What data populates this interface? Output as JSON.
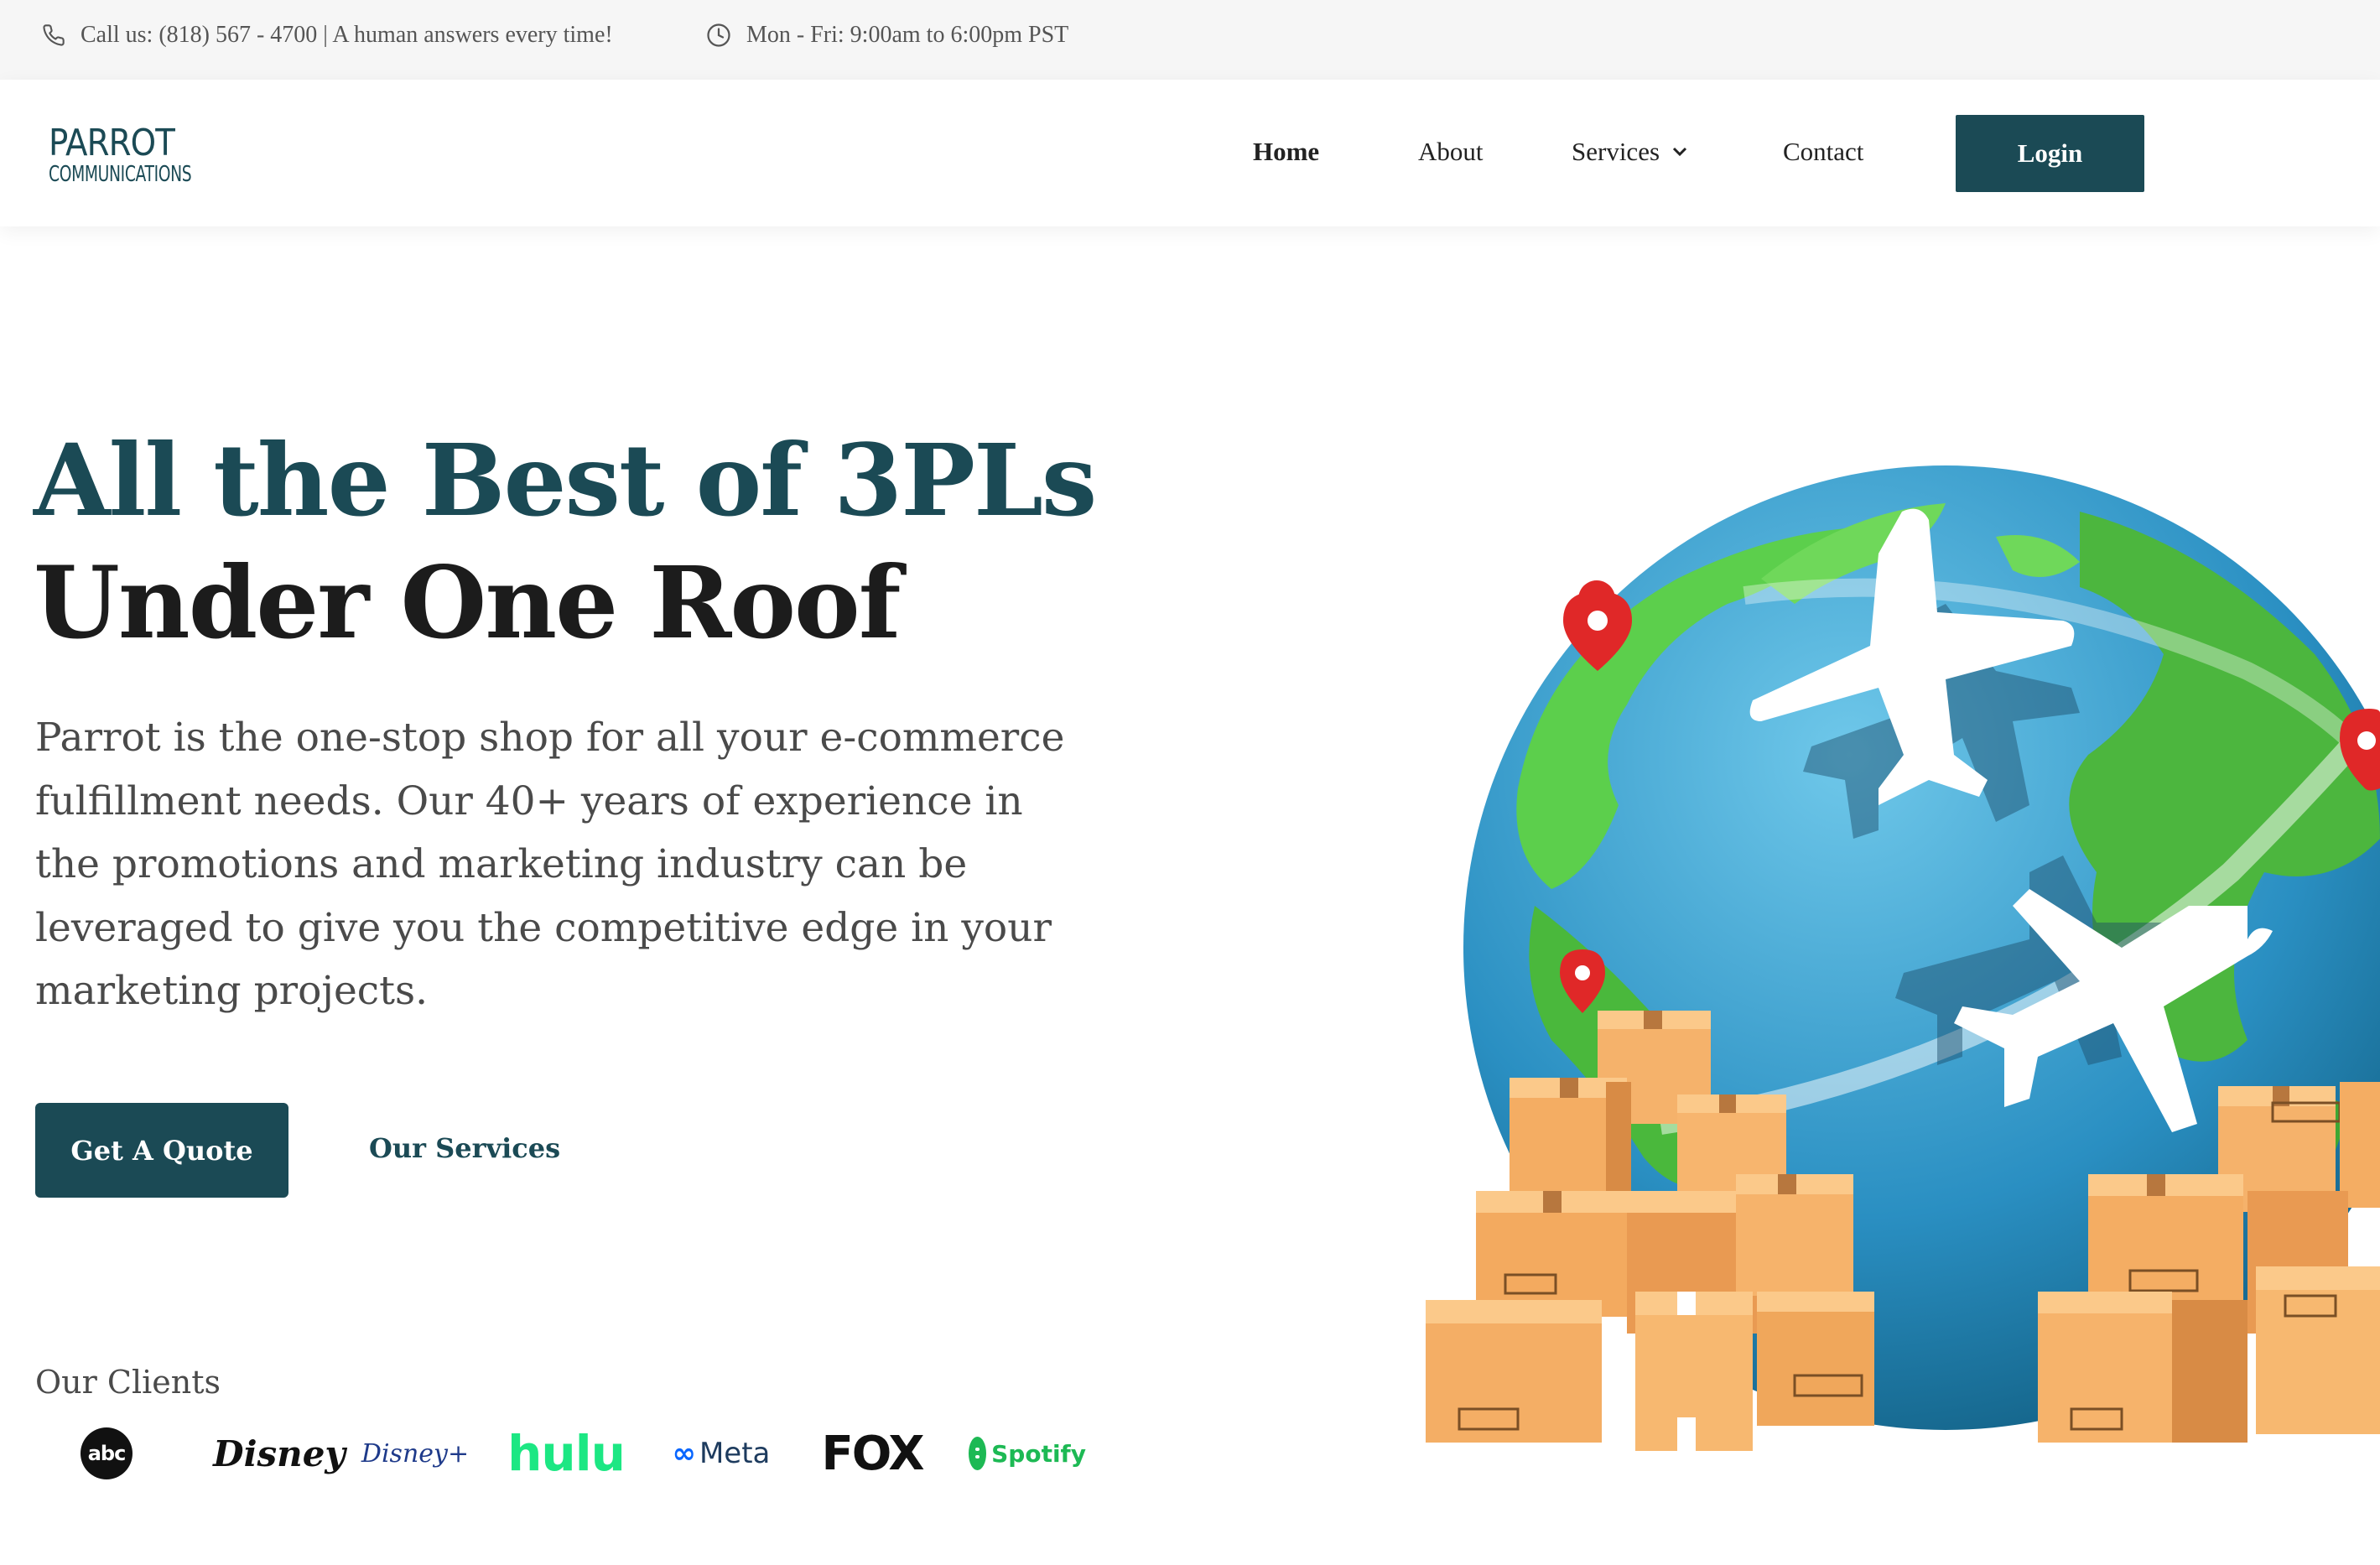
{
  "topbar": {
    "phone_text": "Call us: (818) 567 - 4700 | A human answers every time!",
    "hours_text": "Mon - Fri: 9:00am to 6:00pm PST",
    "phone_icon": "phone-icon",
    "clock_icon": "clock-icon"
  },
  "header": {
    "logo_brand": "PARROT",
    "logo_sub": "COMMUNICATIONS",
    "nav": {
      "home": "Home",
      "about": "About",
      "services": "Services",
      "contact": "Contact"
    },
    "login_label": "Login"
  },
  "hero": {
    "title_line1": "All the Best of 3PLs",
    "title_line2": "Under One Roof",
    "description": "Parrot is the one-stop shop for all your e-commerce fulfillment needs. Our 40+ years of experience in the promotions and marketing industry can be leveraged to give you the competitive edge in your marketing projects.",
    "quote_button": "Get A Quote",
    "services_link": "Our Services"
  },
  "clients": {
    "label": "Our Clients",
    "logos": {
      "abc": "abc",
      "disney": "Disney",
      "disneyplus": "Disney+",
      "hulu": "hulu",
      "meta": "Meta",
      "fox": "FOX",
      "spotify": "Spotify"
    }
  },
  "colors": {
    "brand": "#1b4a55",
    "topbar_bg": "#f6f6f6",
    "hulu": "#1ce783",
    "spotify": "#1db954"
  }
}
